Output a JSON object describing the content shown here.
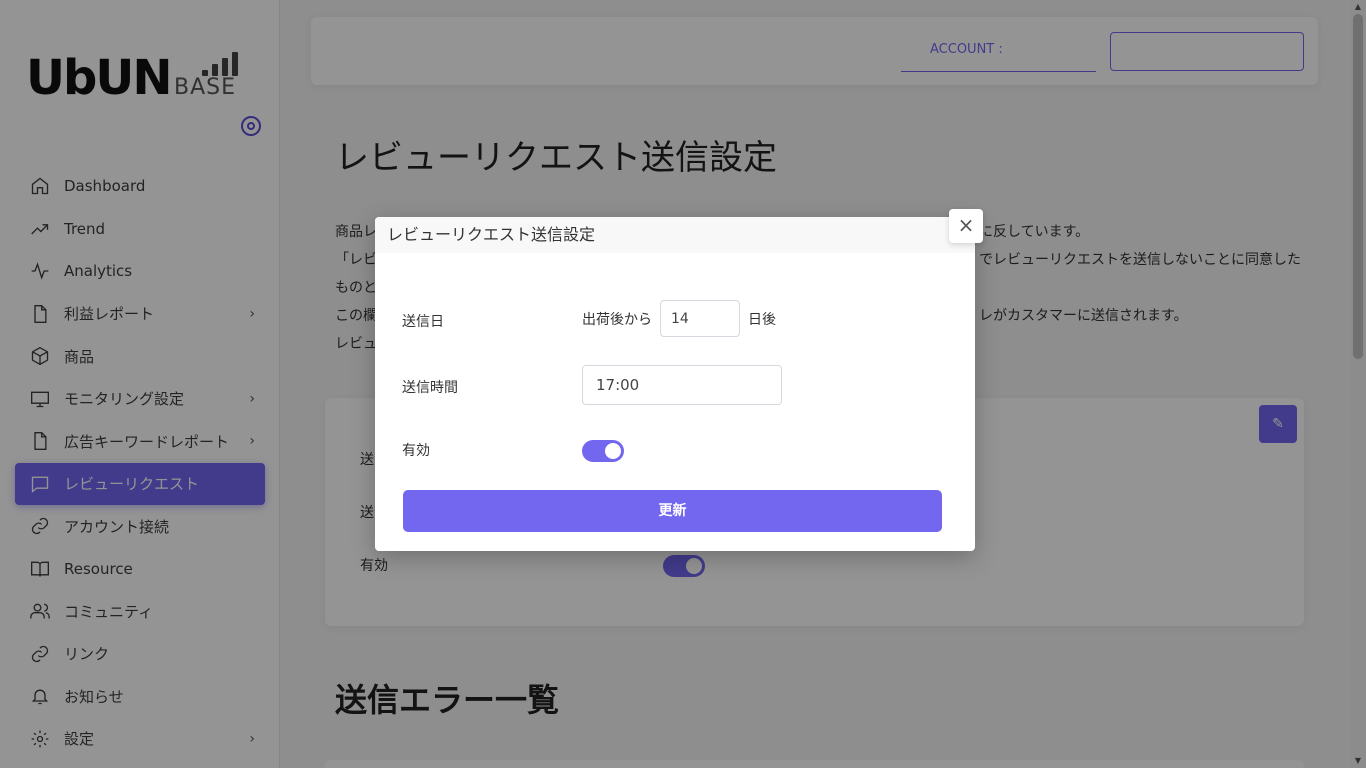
{
  "logo": {
    "main": "UbUN",
    "sub": "BASE"
  },
  "nav": {
    "items": [
      {
        "label": "Dashboard",
        "icon": "home-icon",
        "chevron": false,
        "active": false
      },
      {
        "label": "Trend",
        "icon": "trending-up-icon",
        "chevron": false,
        "active": false
      },
      {
        "label": "Analytics",
        "icon": "activity-icon",
        "chevron": false,
        "active": false
      },
      {
        "label": "利益レポート",
        "icon": "file-icon",
        "chevron": true,
        "active": false
      },
      {
        "label": "商品",
        "icon": "box-icon",
        "chevron": false,
        "active": false
      },
      {
        "label": "モニタリング設定",
        "icon": "monitor-icon",
        "chevron": true,
        "active": false
      },
      {
        "label": "広告キーワードレポート",
        "icon": "file-icon",
        "chevron": true,
        "active": false
      },
      {
        "label": "レビューリクエスト",
        "icon": "message-square-icon",
        "chevron": false,
        "active": true
      },
      {
        "label": "アカウント接続",
        "icon": "link-icon",
        "chevron": false,
        "active": false
      },
      {
        "label": "Resource",
        "icon": "book-open-icon",
        "chevron": false,
        "active": false
      },
      {
        "label": "コミュニティ",
        "icon": "users-icon",
        "chevron": false,
        "active": false
      },
      {
        "label": "リンク",
        "icon": "link-icon",
        "chevron": false,
        "active": false
      },
      {
        "label": "お知らせ",
        "icon": "bell-icon",
        "chevron": false,
        "active": false
      },
      {
        "label": "設定",
        "icon": "settings-icon",
        "chevron": true,
        "active": false
      }
    ],
    "chevron_glyph": "›"
  },
  "header": {
    "account_label": "ACCOUNT :"
  },
  "page": {
    "title": "レビューリクエスト送信設定",
    "desc_lines": [
      "商品レ",
      "「レビ",
      "ものと",
      "この欄",
      "レビュ"
    ],
    "desc_right": [
      "に反しています。",
      "でレビューリクエストを送信しないことに同意した",
      "",
      "レがカスタマーに送信されます。",
      ""
    ],
    "card": {
      "label_1": "送",
      "label_2": "送",
      "label_3": "有効",
      "edit_icon": "✎"
    },
    "section_title": "送信エラー一覧"
  },
  "modal": {
    "title": "レビューリクエスト送信設定",
    "close_glyph": "×",
    "send_day_label": "送信日",
    "send_day_prefix": "出荷後から",
    "send_day_value": "14",
    "send_day_suffix": "日後",
    "send_time_label": "送信時間",
    "send_time_value": "17:00",
    "enabled_label": "有効",
    "submit_label": "更新"
  },
  "colors": {
    "accent": "#7367f0"
  }
}
